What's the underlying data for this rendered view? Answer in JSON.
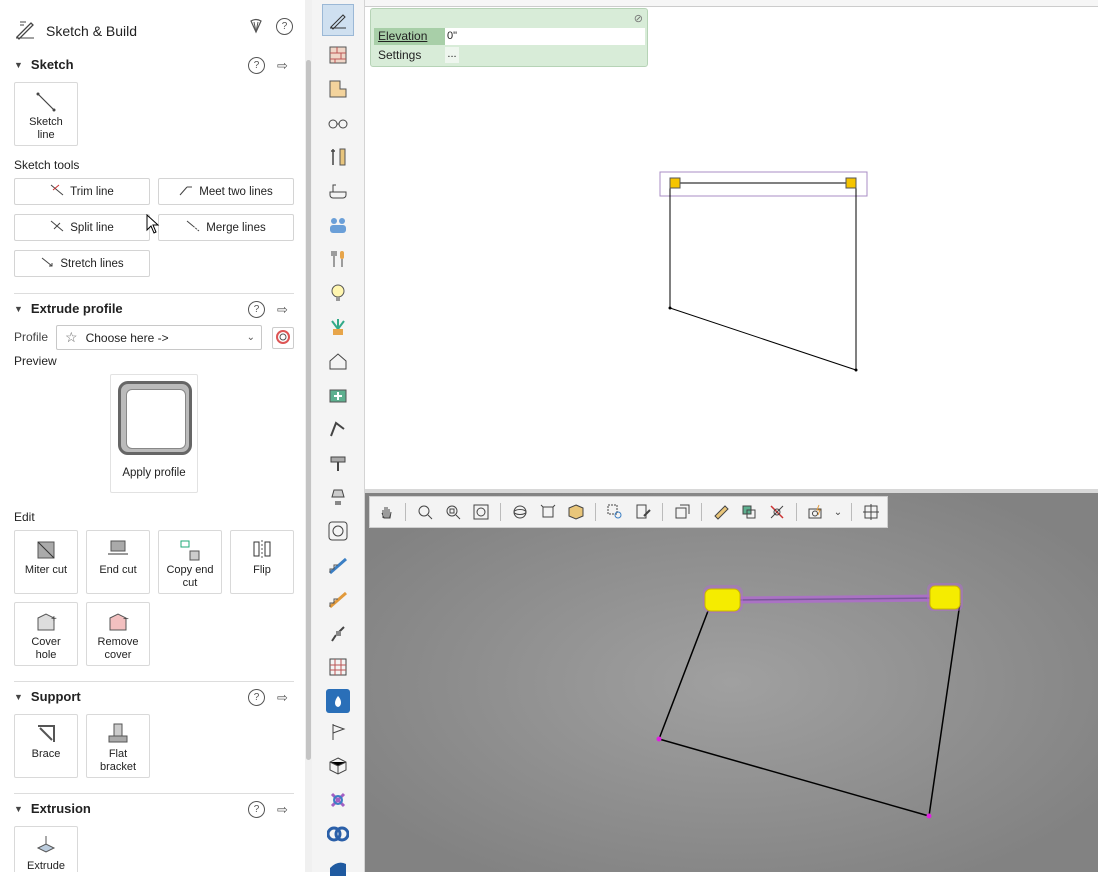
{
  "header": {
    "title": "Sketch & Build",
    "help": "?"
  },
  "sketch": {
    "title": "Sketch",
    "sketch_line_label": "Sketch line",
    "tools_label": "Sketch tools",
    "trim": "Trim line",
    "meet": "Meet two lines",
    "split": "Split line",
    "merge": "Merge lines",
    "stretch": "Stretch lines"
  },
  "extrude": {
    "title": "Extrude profile",
    "profile_label": "Profile",
    "profile_value": "Choose here ->",
    "preview_label": "Preview",
    "apply": "Apply profile",
    "edit_label": "Edit",
    "miter": "Miter cut",
    "end": "End cut",
    "copy_end": "Copy end cut",
    "flip": "Flip",
    "cover": "Cover hole",
    "remove_cover": "Remove cover"
  },
  "support": {
    "title": "Support",
    "brace": "Brace",
    "flat": "Flat bracket"
  },
  "extrusion": {
    "title": "Extrusion",
    "extrude": "Extrude"
  },
  "properties": {
    "elevation_label": "Elevation",
    "elevation_value": "0\"",
    "settings_label": "Settings",
    "settings_value": "..."
  },
  "colors": {
    "accent": "#4a7fb5",
    "handle": "#f5c400",
    "selection": "#b06ad0",
    "panel_green": "#d8ecd8"
  }
}
